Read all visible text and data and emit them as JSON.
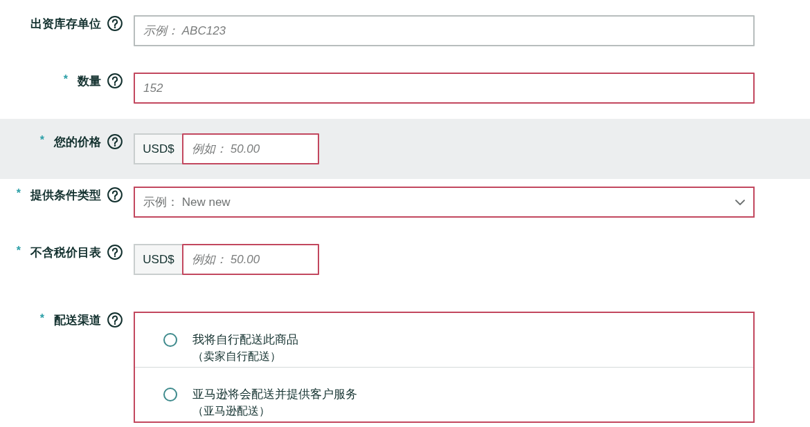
{
  "fields": [
    {
      "kind": "text",
      "label": "出资库存单位",
      "placeholder": "示例： ABC123",
      "error": false,
      "highlighted": false
    },
    {
      "kind": "text",
      "required_mark": "*",
      "label": "数量",
      "placeholder": "152",
      "error": true,
      "highlighted": false
    },
    {
      "kind": "currency",
      "required_mark": "*",
      "label": "您的价格",
      "currency": "USD$",
      "placeholder": "例如： 50.00",
      "error": true,
      "highlighted": true
    },
    {
      "kind": "select",
      "required_mark": "*",
      "label": "提供条件类型",
      "placeholder": "示例： New new",
      "error": true,
      "highlighted": false
    },
    {
      "kind": "currency",
      "required_mark": "*",
      "label": "不含税价目表",
      "currency": "USD$",
      "placeholder": "例如： 50.00",
      "error": true,
      "highlighted": false
    },
    {
      "kind": "radio",
      "required_mark": "*",
      "label": "配送渠道",
      "error": true,
      "highlighted": false,
      "options": [
        {
          "label": "我将自行配送此商品",
          "note": "（卖家自行配送）",
          "selected": false
        },
        {
          "label": "亚马逊将会配送并提供客户服务",
          "note": "（亚马逊配送）",
          "selected": false
        }
      ]
    }
  ]
}
